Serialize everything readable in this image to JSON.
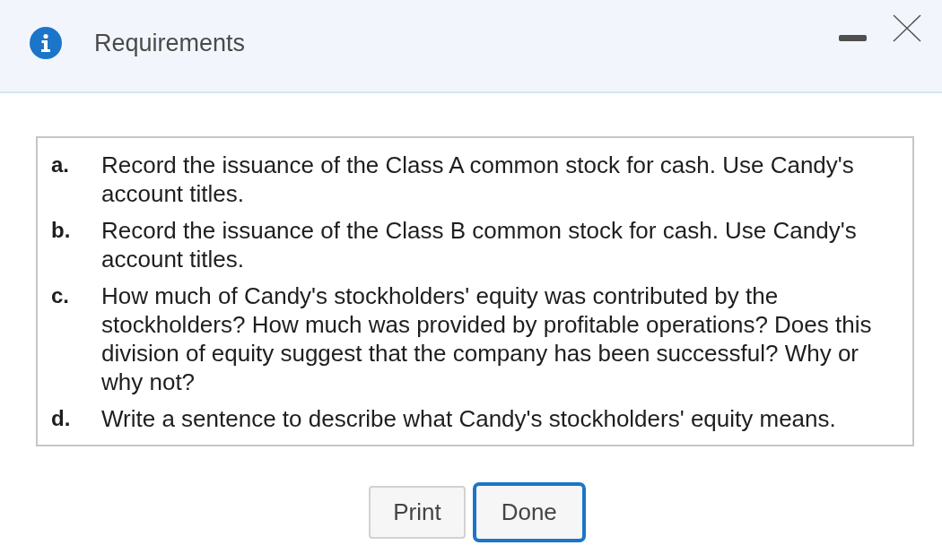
{
  "dialog": {
    "title": "Requirements"
  },
  "requirements": [
    {
      "label": "a.",
      "text": "Record the issuance of the Class A common stock for cash. Use Candy's account titles."
    },
    {
      "label": "b.",
      "text": "Record the issuance of the Class B common stock for cash. Use Candy's account titles."
    },
    {
      "label": "c.",
      "text": "How much of Candy's stockholders' equity was contributed by the stockholders? How much was provided by profitable operations? Does this division of equity suggest that the company has been successful? Why or why not?"
    },
    {
      "label": "d.",
      "text": "Write a sentence to describe what Candy's stockholders' equity means."
    }
  ],
  "buttons": [
    {
      "label": "Print",
      "focused": false
    },
    {
      "label": "Done",
      "focused": true
    }
  ]
}
